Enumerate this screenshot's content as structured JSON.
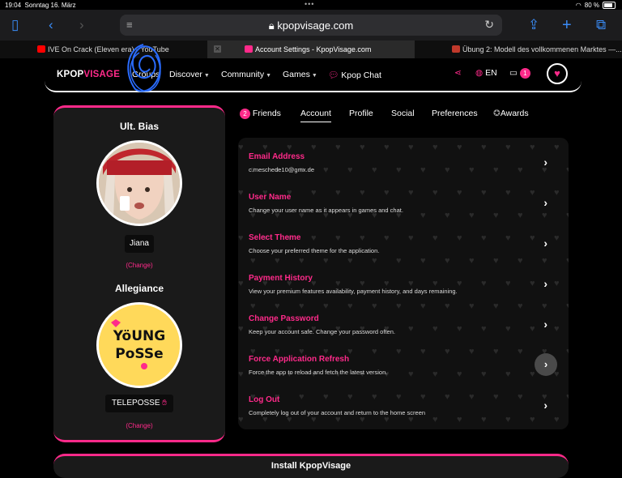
{
  "status": {
    "time": "19:04",
    "date": "Sonntag 16. März",
    "battery": "80 %"
  },
  "browser": {
    "url": "kpopvisage.com"
  },
  "tabs": [
    {
      "label": "IVE On Crack (Eleven era) - YouTube",
      "fav_color": "#ff0000"
    },
    {
      "label": "Account Settings - KpopVisage.com",
      "fav_color": "#ff2a8a"
    },
    {
      "label": "Übung 2: Modell des vollkommenen Marktes —...",
      "fav_color": "#c0392b"
    }
  ],
  "nav": {
    "logo_a": "KPOP",
    "logo_b": "VISAGE",
    "items": [
      "Groups",
      "Discover",
      "Community",
      "Games"
    ],
    "chat": "Kpop Chat",
    "lang": "EN",
    "inbox_count": "1"
  },
  "left": {
    "bias_title": "Ult. Bias",
    "bias_name": "Jiana",
    "change": "(Change)",
    "allegiance_title": "Allegiance",
    "allegiance_name": "TELEPOSSE",
    "logo_text_a": "YöUNG",
    "logo_text_b": "PoSSe"
  },
  "subtabs": {
    "friends_count": "2",
    "items": [
      "Friends",
      "Account",
      "Profile",
      "Social",
      "Preferences",
      "Awards"
    ]
  },
  "settings": [
    {
      "title": "Email Address",
      "desc": "c.meschede10@gmx.de"
    },
    {
      "title": "User Name",
      "desc": "Change your user name as it appears in games and chat."
    },
    {
      "title": "Select Theme",
      "desc": "Choose your preferred theme for the application."
    },
    {
      "title": "Payment History",
      "desc": "View your premium features availability, payment history, and days remaining."
    },
    {
      "title": "Change Password",
      "desc": "Keep your account safe. Change your password often."
    },
    {
      "title": "Force Application Refresh",
      "desc": "Force the app to reload and fetch the latest version."
    },
    {
      "title": "Log Out",
      "desc": "Completely log out of your account and return to the home screen"
    }
  ],
  "bottom": {
    "title": "Install KpopVisage"
  },
  "colors": {
    "accent": "#ff2a8a",
    "panel": "#111111",
    "card": "#1a1a1a"
  }
}
